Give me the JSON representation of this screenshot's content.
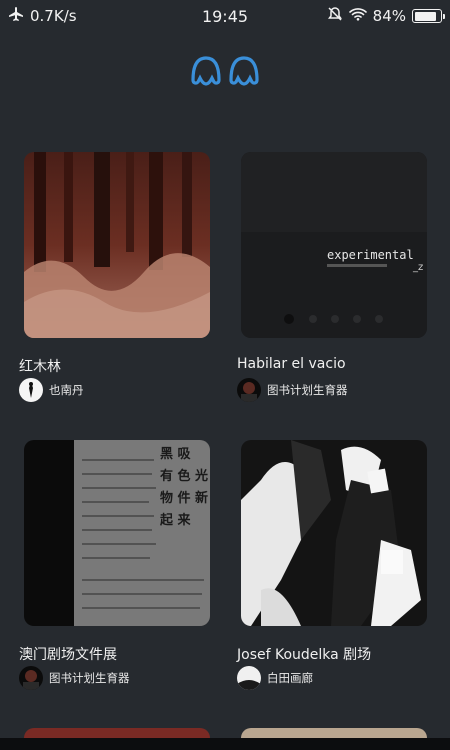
{
  "status_bar": {
    "net_speed": "0.7K/s",
    "time": "19:45",
    "battery_percent": "84%",
    "battery_level": 0.84
  },
  "cards": [
    {
      "title": "红木林",
      "author": "也南丹",
      "thumb_icon": "forest-photo"
    },
    {
      "title": "Habilar el vacio",
      "author": "图书计划生育器",
      "thumb_icon": "dark-video-still",
      "thumb_text": "experimental",
      "thumb_subtext": "_z"
    },
    {
      "title": "澳门剧场文件展",
      "author": "图书计划生育器",
      "thumb_icon": "newspaper-photo",
      "thumb_chars": "黑 吸\n有 色 光\n物 件 新\n起 来"
    },
    {
      "title": "Josef Koudelka 剧场",
      "author": "白田画廊",
      "thumb_icon": "bw-theatre-photo"
    }
  ],
  "colors": {
    "background": "#262a2f",
    "logo_blue": "#3a8fd9"
  }
}
